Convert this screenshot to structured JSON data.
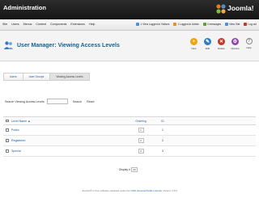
{
  "header": {
    "title": "Administration",
    "logo_text": "Joomla!"
  },
  "menubar": {
    "items": [
      "Site",
      "Users",
      "Menus",
      "Content",
      "Components",
      "Extensions",
      "Help"
    ],
    "status": [
      {
        "label": "1 View Logged-in Visitors",
        "color": "#4c8fd6"
      },
      {
        "label": "1 Logged-in Admin",
        "color": "#e28e2a"
      },
      {
        "label": "0 messages",
        "color": "#5d9f3b"
      },
      {
        "label": "View Site",
        "color": "#4c8fd6"
      },
      {
        "label": "Log out",
        "color": "#c0392b"
      }
    ]
  },
  "toolbar": {
    "title": "User Manager: Viewing Access Levels",
    "buttons": [
      {
        "name": "new",
        "label": "New",
        "glyph": "+",
        "color": "#f0a30a"
      },
      {
        "name": "edit",
        "label": "Edit",
        "glyph": "✎",
        "color": "#2d7fc1"
      },
      {
        "name": "delete",
        "label": "Delete",
        "glyph": "✕",
        "color": "#c0392b"
      },
      {
        "name": "options",
        "label": "Options",
        "glyph": "⚙",
        "color": "#8e44ad"
      },
      {
        "name": "help",
        "label": "Help",
        "glyph": "?",
        "color": "#888888"
      }
    ]
  },
  "subtabs": [
    "Users",
    "User Groups",
    "Viewing Access Levels"
  ],
  "filter": {
    "label": "Search Viewing Access Levels",
    "value": "",
    "search_label": "Search",
    "reset_label": "Reset"
  },
  "table": {
    "columns": {
      "title": "Level Name ▲",
      "ordering": "Ordering",
      "id": "ID"
    },
    "rows": [
      {
        "title": "Public",
        "order": "1",
        "id": "1"
      },
      {
        "title": "Registered",
        "order": "2",
        "id": "2"
      },
      {
        "title": "Special",
        "order": "3",
        "id": "3"
      }
    ]
  },
  "pagination": {
    "label": "Display #",
    "value": "20"
  },
  "footer": {
    "text_prefix": "Joomla!® is free software released under the ",
    "link_text": "GNU General Public License",
    "version": ". Version 1.6.0"
  }
}
